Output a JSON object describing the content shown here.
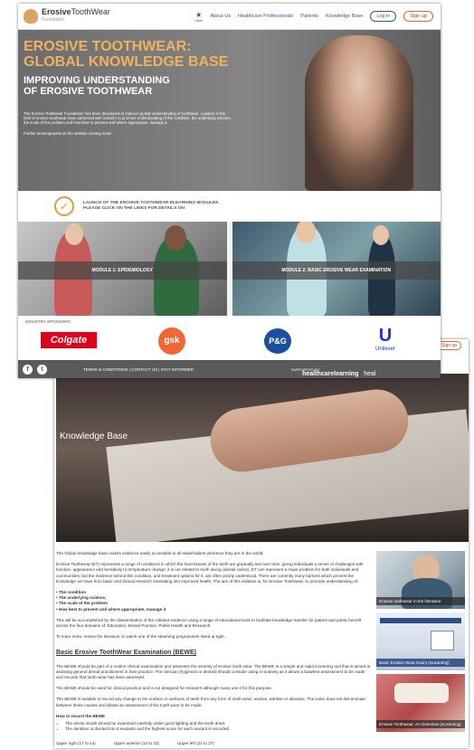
{
  "page1": {
    "logo": {
      "brand_bold": "Erosive",
      "brand_rest": "ToothWear",
      "sub": "Foundation"
    },
    "nav": {
      "home_label": "Home",
      "items": [
        "About Us",
        "Healthcare Professionals",
        "Patients",
        "Knowledge Base"
      ],
      "login": "Log in",
      "signup": "Sign up"
    },
    "hero": {
      "title_line1": "EROSIVE TOOTHWEAR:",
      "title_line2": "GLOBAL KNOWLEDGE BASE",
      "subtitle_line1": "IMPROVING UNDERSTANDING",
      "subtitle_line2": "OF EROSIVE TOOTHWEAR",
      "body": "The Erosive Toothwear Foundation has been developed to improve global understanding of toothwear. Leaders in the field of erosive toothwear have partnered with industry to promote understanding of the condition, the underlying science, the scale of the problem and how best to prevent and where appropriate, manage it.",
      "note": "Further developments on the website coming soon!"
    },
    "launch": {
      "line1": "LAUNCH OF THE EROSIVE TOOTHWEAR ELEARNING MODULES",
      "line2": "PLEASE CLICK ON THE LINKS FOR DETAILS ON:"
    },
    "modules": [
      {
        "label": "MODULE 1: EPIDEMIOLOGY"
      },
      {
        "label": "MODULE 2: BASIC EROSIVE WEAR EXAMINATION"
      }
    ],
    "sponsors": {
      "heading": "INDUSTRY SPONSORS:",
      "colgate": "Colgate",
      "gsk": "gsk",
      "pg": "P&G",
      "unilever": "Unilever"
    },
    "footer": {
      "links": "TERMS & CONDITIONS | CONTACT US | STAY INFORMED",
      "supported": "SUPPORTED BY:",
      "partner": "healthcarelearning",
      "partner2": "heal"
    }
  },
  "page2": {
    "signup": "Sign up",
    "hero_title": "Knowledge Base",
    "intro": "The Global knowledge base makes evidence easily accessible to all stakeholders wherever they are in the world.",
    "para1": "Erosive Toothwear (ET) represents a range of conditions in which the hard tissues of the teeth are gradually lost over time, giving individuals a series of challenges with function, appearance and sensitivity to temperature change; it is not related to tooth decay (dental caries). ET can represent a major problem for both individuals and communities, but the evidence behind this condition, and treatment options for it, are often poorly understood. There are currently many barriers which prevent the knowledge we have from basic and clinical research translating into improved health. The aim of this initiative is, for Erosive Toothwear, to promote understanding of:",
    "bullets": [
      "• The condition",
      "• The underlying science,",
      "• The scale of the problem",
      "• How best to prevent and where appropriate, manage it"
    ],
    "para2": "This will be accomplished by the dissemination of the collated evidence using a range of educational tools to facilitate knowledge transfer for patient and public benefit across the four domains of: Education, Dental Practice, Public Health and Research.",
    "para3": "To learn more, review the literature or watch one of the elearning programmes listed at right.",
    "bewe_heading": "Basic Erosive ToothWear Examination (BEWE)",
    "bewe1": "The BEWE should be part of a routine clinical examination and assesses the severity of erosive tooth wear. The BEWE is a simple and rapid screening tool that is aimed at assisting general dental practitioners in their practice. The clinician (hygienist or dentist) should consider using it routinely as it allows a baseline assessment to be made and records that tooth wear has been assessed.",
    "bewe2": "The BEWE should be used for clinical practice and is not designed for research although many use it for this purpose.",
    "bewe3": "The BEWE is suitable to record any change to the surface or surfaces of teeth from any form of tooth wear; erosive, attritive or abrasive. The index does not discriminate between these causes and allows an assessment of the tooth wear to be made.",
    "how_heading": "How to record the BEWE",
    "how_items": [
      "The whole mouth should be examined carefully under good lighting and the teeth dried.",
      "The dentition is divided into 6 sextants and the highest score for each sextant is recorded."
    ],
    "sextants": [
      "Upper right (17 to 14)",
      "Upper anterior (13 to 23)",
      "Upper left (24 to 27)"
    ],
    "sidebar": [
      {
        "label": "Erosive toothwear in the literature"
      },
      {
        "label": "Basic Erosive Wear Exam (eLearning)"
      },
      {
        "label": "Erosive Toothwear: An Overview (eLearning)"
      }
    ]
  }
}
